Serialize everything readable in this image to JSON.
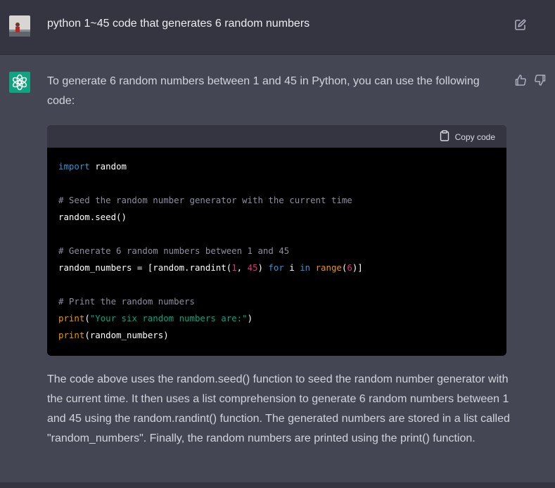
{
  "user_message": {
    "text": "python 1~45 code that generates 6 random numbers",
    "avatar_icon": "user-avatar",
    "edit_icon": "edit-icon"
  },
  "assistant_message": {
    "intro": "To generate 6 random numbers between 1 and 45 in Python, you can use the following code:",
    "code_block": {
      "copy_label": "Copy code",
      "lines": {
        "l1_kw": "import",
        "l1_rest": " random",
        "l3": "# Seed the random number generator with the current time",
        "l4": "random.seed()",
        "l6": "# Generate 6 random numbers between 1 and 45",
        "l7_a": "random_numbers = [random.randint(",
        "l7_n1": "1",
        "l7_b": ", ",
        "l7_n2": "45",
        "l7_c": ") ",
        "l7_for": "for",
        "l7_d": " i ",
        "l7_in": "in",
        "l7_e": " ",
        "l7_range": "range",
        "l7_f": "(",
        "l7_n3": "6",
        "l7_g": ")]",
        "l9": "# Print the random numbers",
        "l10_fn": "print",
        "l10_a": "(",
        "l10_str": "\"Your six random numbers are:\"",
        "l10_b": ")",
        "l11_fn": "print",
        "l11_a": "(random_numbers)"
      }
    },
    "outro": "The code above uses the random.seed() function to seed the random number generator with the current time. It then uses a list comprehension to generate 6 random numbers between 1 and 45 using the random.randint() function. The generated numbers are stored in a list called \"random_numbers\". Finally, the random numbers are printed using the print() function."
  },
  "colors": {
    "user_bg": "#343541",
    "assistant_bg": "#444654",
    "accent": "#10a37f"
  }
}
